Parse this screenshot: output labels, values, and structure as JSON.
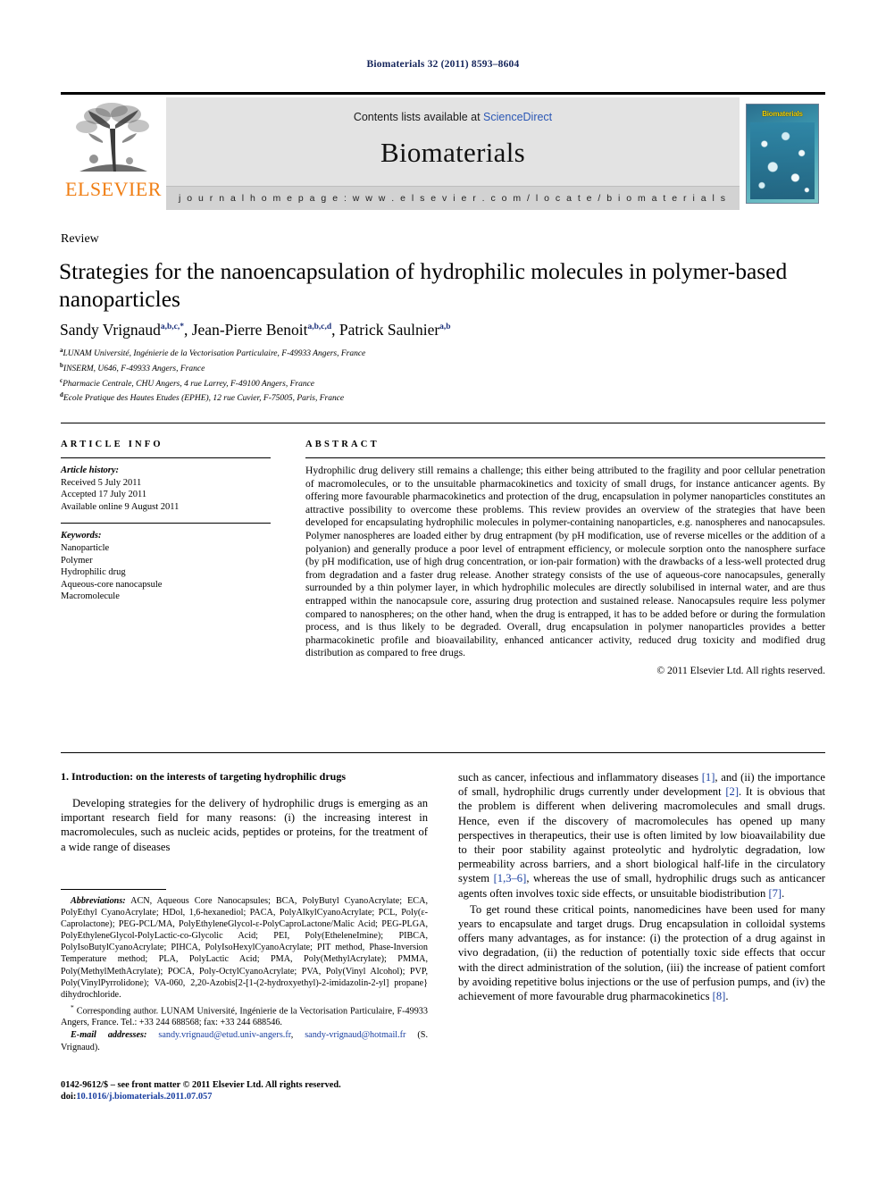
{
  "running_head": "Biomaterials 32 (2011) 8593–8604",
  "masthead": {
    "publisher_name": "ELSEVIER",
    "contents_prefix": "Contents lists available at ",
    "contents_link": "ScienceDirect",
    "journal_name": "Biomaterials",
    "homepage_line": "j o u r n a l   h o m e p a g e :   w w w . e l s e v i e r . c o m / l o c a t e / b i o m a t e r i a l s",
    "cover_title": "Biomaterials"
  },
  "article": {
    "kind": "Review",
    "title": "Strategies for the nanoencapsulation of hydrophilic molecules in polymer-based nanoparticles",
    "authors": [
      {
        "name": "Sandy Vrignaud",
        "marks": "a,b,c,*"
      },
      {
        "name": "Jean-Pierre Benoit",
        "marks": "a,b,c,d"
      },
      {
        "name": "Patrick Saulnier",
        "marks": "a,b"
      }
    ],
    "affiliations": [
      {
        "mark": "a",
        "text": "LUNAM Université, Ingénierie de la Vectorisation Particulaire, F-49933 Angers, France"
      },
      {
        "mark": "b",
        "text": "INSERM, U646, F-49933 Angers, France"
      },
      {
        "mark": "c",
        "text": "Pharmacie Centrale, CHU Angers, 4 rue Larrey, F-49100 Angers, France"
      },
      {
        "mark": "d",
        "text": "Ecole Pratique des Hautes Etudes (EPHE), 12 rue Cuvier, F-75005, Paris, France"
      }
    ]
  },
  "info": {
    "heading": "ARTICLE INFO",
    "history_label": "Article history:",
    "history": [
      "Received 5 July 2011",
      "Accepted 17 July 2011",
      "Available online 9 August 2011"
    ],
    "keywords_label": "Keywords:",
    "keywords": [
      "Nanoparticle",
      "Polymer",
      "Hydrophilic drug",
      "Aqueous-core nanocapsule",
      "Macromolecule"
    ]
  },
  "abstract": {
    "heading": "ABSTRACT",
    "text": "Hydrophilic drug delivery still remains a challenge; this either being attributed to the fragility and poor cellular penetration of macromolecules, or to the unsuitable pharmacokinetics and toxicity of small drugs, for instance anticancer agents. By offering more favourable pharmacokinetics and protection of the drug, encapsulation in polymer nanoparticles constitutes an attractive possibility to overcome these problems. This review provides an overview of the strategies that have been developed for encapsulating hydrophilic molecules in polymer-containing nanoparticles, e.g. nanospheres and nanocapsules. Polymer nanospheres are loaded either by drug entrapment (by pH modification, use of reverse micelles or the addition of a polyanion) and generally produce a poor level of entrapment efficiency, or molecule sorption onto the nanosphere surface (by pH modification, use of high drug concentration, or ion-pair formation) with the drawbacks of a less-well protected drug from degradation and a faster drug release. Another strategy consists of the use of aqueous-core nanocapsules, generally surrounded by a thin polymer layer, in which hydrophilic molecules are directly solubilised in internal water, and are thus entrapped within the nanocapsule core, assuring drug protection and sustained release. Nanocapsules require less polymer compared to nanospheres; on the other hand, when the drug is entrapped, it has to be added before or during the formulation process, and is thus likely to be degraded. Overall, drug encapsulation in polymer nanoparticles provides a better pharmacokinetic profile and bioavailability, enhanced anticancer activity, reduced drug toxicity and modified drug distribution as compared to free drugs.",
    "copyright": "© 2011 Elsevier Ltd. All rights reserved."
  },
  "body": {
    "section_number_title": "1.  Introduction: on the interests of targeting hydrophilic drugs",
    "left_paragraph_1": "Developing strategies for the delivery of hydrophilic drugs is emerging as an important research field for many reasons: (i) the increasing interest in macromolecules, such as nucleic acids, peptides or proteins, for the treatment of a wide range of diseases",
    "right_paragraph_1_part1": "such as cancer, infectious and inflammatory diseases ",
    "right_ref_1": "[1]",
    "right_paragraph_1_part2": ", and (ii) the importance of small, hydrophilic drugs currently under development ",
    "right_ref_2": "[2]",
    "right_paragraph_1_part3": ". It is obvious that the problem is different when delivering macromolecules and small drugs. Hence, even if the discovery of macromolecules has opened up many perspectives in therapeutics, their use is often limited by low bioavailability due to their poor stability against proteolytic and hydrolytic degradation, low permeability across barriers, and a short biological half-life in the circulatory system ",
    "right_ref_3": "[1,3–6]",
    "right_paragraph_1_part4": ", whereas the use of small, hydrophilic drugs such as anticancer agents often involves toxic side effects, or unsuitable biodistribution ",
    "right_ref_4": "[7]",
    "right_paragraph_1_part5": ".",
    "right_paragraph_2_part1": "To get round these critical points, nanomedicines have been used for many years to encapsulate and target drugs. Drug encapsulation in colloidal systems offers many advantages, as for instance: (i) the protection of a drug against in vivo degradation, (ii) the reduction of potentially toxic side effects that occur with the direct administration of the solution, (iii) the increase of patient comfort by avoiding repetitive bolus injections or the use of perfusion pumps, and (iv) the achievement of more favourable drug pharmacokinetics ",
    "right_ref_5": "[8]",
    "right_paragraph_2_part2": "."
  },
  "footnotes": {
    "abbreviations_label": "Abbreviations:",
    "abbreviations_text": " ACN, Aqueous Core Nanocapsules; BCA, PolyButyl CyanoAcrylate; ECA, PolyEthyl CyanoAcrylate; HDol, 1,6-hexanediol; PACA, PolyAlkylCyanoAcrylate; PCL, Poly(ε-Caprolactone); PEG-PCL/MA, PolyEthyleneGlycol-ε-PolyCaproLactone/Malic Acid; PEG-PLGA, PolyEthyleneGlycol-PolyLactic-co-Glycolic Acid; PEI, Poly(EtheleneImine); PIBCA, PolyIsoButylCyanoAcrylate; PIHCA, PolyIsoHexylCyanoAcrylate; PIT method, Phase-Inversion Temperature method; PLA, PolyLactic Acid; PMA, Poly(MethylAcrylate); PMMA, Poly(MethylMethAcrylate); POCA, Poly-OctylCyanoAcrylate; PVA, Poly(Vinyl Alcohol); PVP, Poly(VinylPyrrolidone); VA-060, 2,20-Azobis[2-[1-(2-hydroxyethyl)-2-imidazolin-2-yl] propane} dihydrochloride.",
    "corresponding_mark": "*",
    "corresponding_text": " Corresponding author. LUNAM Université, Ingénierie de la Vectorisation Particulaire, F-49933 Angers, France. Tel.: +33 244 688568; fax: +33 244 688546.",
    "email_label": "E-mail addresses:",
    "email_1": "sandy.vrignaud@etud.univ-angers.fr",
    "email_sep": ", ",
    "email_2": "sandy-vrignaud@hotmail.fr",
    "email_suffix": " (S. Vrignaud)."
  },
  "footer": {
    "issn_line": "0142-9612/$ – see front matter © 2011 Elsevier Ltd. All rights reserved.",
    "doi_label": "doi:",
    "doi_value": "10.1016/j.biomaterials.2011.07.057"
  },
  "colors": {
    "running_head": "#14245a",
    "link": "#1a3fa0",
    "elsevier_orange": "#f07e13",
    "masthead_gray": "#e3e3e3"
  }
}
